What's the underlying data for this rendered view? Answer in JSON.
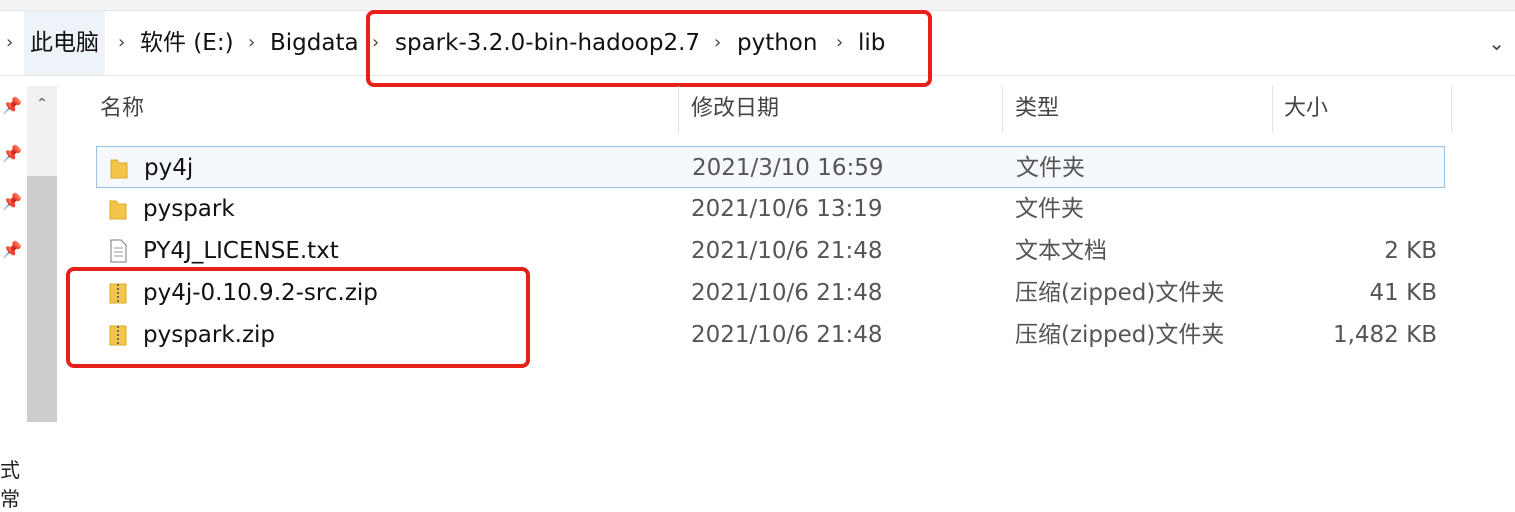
{
  "breadcrumb": {
    "items": [
      "此电脑",
      "软件 (E:)",
      "Bigdata",
      "spark-3.2.0-bin-hadoop2.7",
      "python",
      "lib"
    ]
  },
  "columns": {
    "name": "名称",
    "modified": "修改日期",
    "type": "类型",
    "size": "大小"
  },
  "files": [
    {
      "name": "py4j",
      "modified": "2021/3/10 16:59",
      "type": "文件夹",
      "size": "",
      "icon": "folder-icon"
    },
    {
      "name": "pyspark",
      "modified": "2021/10/6 13:19",
      "type": "文件夹",
      "size": "",
      "icon": "folder-icon"
    },
    {
      "name": "PY4J_LICENSE.txt",
      "modified": "2021/10/6 21:48",
      "type": "文本文档",
      "size": "2 KB",
      "icon": "text-file-icon"
    },
    {
      "name": "py4j-0.10.9.2-src.zip",
      "modified": "2021/10/6 21:48",
      "type": "压缩(zipped)文件夹",
      "size": "41 KB",
      "icon": "zip-folder-icon"
    },
    {
      "name": "pyspark.zip",
      "modified": "2021/10/6 21:48",
      "type": "压缩(zipped)文件夹",
      "size": "1,482 KB",
      "icon": "zip-folder-icon"
    }
  ],
  "sidebar_clipped_text": "式常",
  "colors": {
    "highlight_border": "#e8201c",
    "selection_border": "#99c3e6",
    "folder": "#f3c54a"
  }
}
